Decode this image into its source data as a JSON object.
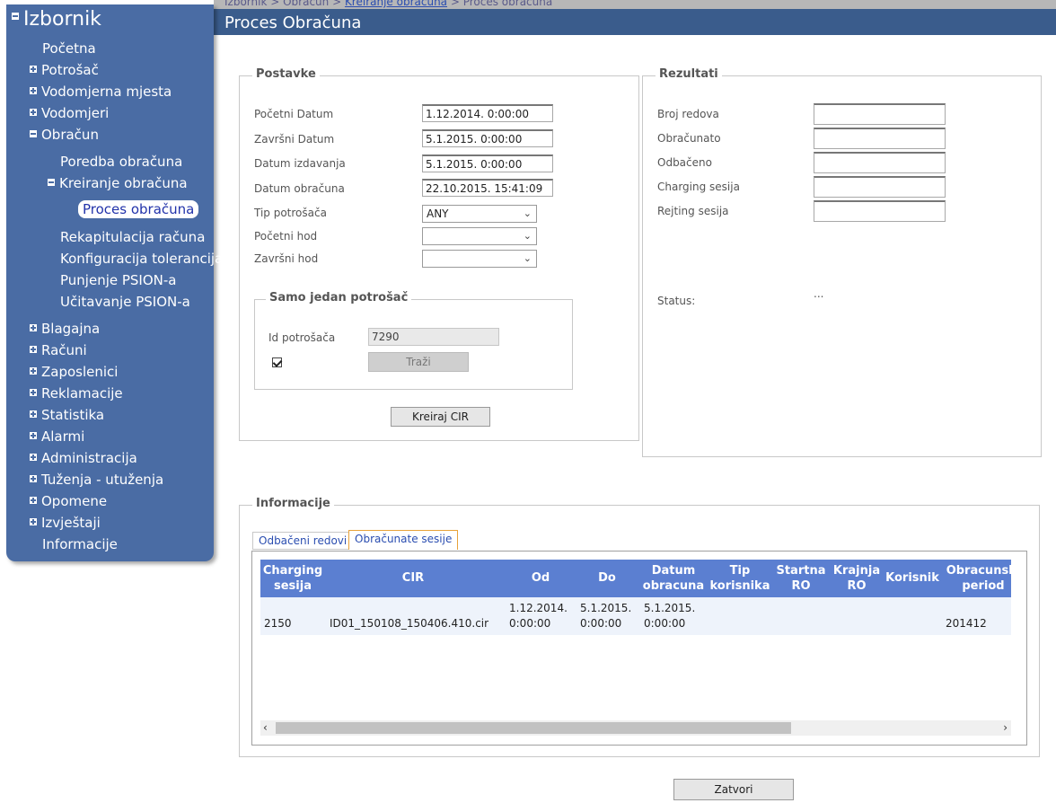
{
  "breadcrumb": {
    "part1": "Izbornik > Obračun > ",
    "link": "Kreiranje obračuna",
    "part3": " > Proces obračuna"
  },
  "page_title": "Proces Obračuna",
  "sidebar": {
    "title": "Izbornik",
    "items": [
      {
        "label": "Početna"
      },
      {
        "label": "Potrošač"
      },
      {
        "label": "Vodomjerna mjesta"
      },
      {
        "label": "Vodomjeri"
      },
      {
        "label": "Obračun"
      },
      {
        "label": "Poredba obračuna"
      },
      {
        "label": "Kreiranje obračuna"
      },
      {
        "label": "Proces obračuna"
      },
      {
        "label": "Rekapitulacija računa"
      },
      {
        "label": "Konfiguracija tolerancija"
      },
      {
        "label": "Punjenje PSION-a"
      },
      {
        "label": "Učitavanje PSION-a"
      },
      {
        "label": "Blagajna"
      },
      {
        "label": "Računi"
      },
      {
        "label": "Zaposlenici"
      },
      {
        "label": "Reklamacije"
      },
      {
        "label": "Statistika"
      },
      {
        "label": "Alarmi"
      },
      {
        "label": "Administracija"
      },
      {
        "label": "Tuženja - utuženja"
      },
      {
        "label": "Opomene"
      },
      {
        "label": "Izvještaji"
      },
      {
        "label": "Informacije"
      }
    ]
  },
  "postavke": {
    "legend": "Postavke",
    "pocetni_datum_label": "Početni Datum",
    "pocetni_datum": "1.12.2014. 0:00:00",
    "zavrsni_datum_label": "Završni Datum",
    "zavrsni_datum": "5.1.2015. 0:00:00",
    "datum_izdavanja_label": "Datum izdavanja",
    "datum_izdavanja": "5.1.2015. 0:00:00",
    "datum_obracuna_label": "Datum obračuna",
    "datum_obracuna": "22.10.2015. 15:41:09",
    "tip_potrosaca_label": "Tip potrošača",
    "tip_potrosaca": "ANY",
    "pocetni_hod_label": "Početni hod",
    "pocetni_hod": "",
    "zavrsni_hod_label": "Završni hod",
    "zavrsni_hod": "",
    "samo_legend": "Samo jedan potrošač",
    "id_label": "Id potrošača",
    "id_value": "7290",
    "trazi_label": "Traži",
    "kreiraj_label": "Kreiraj CIR"
  },
  "rezultati": {
    "legend": "Rezultati",
    "broj_redova": "Broj redova",
    "obracunato": "Obračunato",
    "odbaceno": "Odbačeno",
    "charging": "Charging sesija",
    "rejting": "Rejting sesija",
    "status_label": "Status:",
    "status_value": "..."
  },
  "informacije": {
    "legend": "Informacije",
    "tab1": "Odbačeni redovi",
    "tab2": "Obračunate sesije",
    "headers": {
      "charging1": "Charging",
      "charging2": "sesija",
      "cir": "CIR",
      "od": "Od",
      "do": "Do",
      "datum1": "Datum",
      "datum2": "obracuna",
      "tip1": "Tip",
      "tip2": "korisnika",
      "startna1": "Startna",
      "startna2": "RO",
      "krajnja1": "Krajnja",
      "krajnja2": "RO",
      "korisnik": "Korisnik",
      "period1": "Obracunski",
      "period2": "period"
    },
    "row": {
      "charging": "2150",
      "cir": "ID01_150108_150406.410.cir",
      "od1": "1.12.2014.",
      "od2": "0:00:00",
      "do1": "5.1.2015.",
      "do2": "0:00:00",
      "datum1": "5.1.2015.",
      "datum2": "0:00:00",
      "period": "201412"
    }
  },
  "zatvori_label": "Zatvori"
}
